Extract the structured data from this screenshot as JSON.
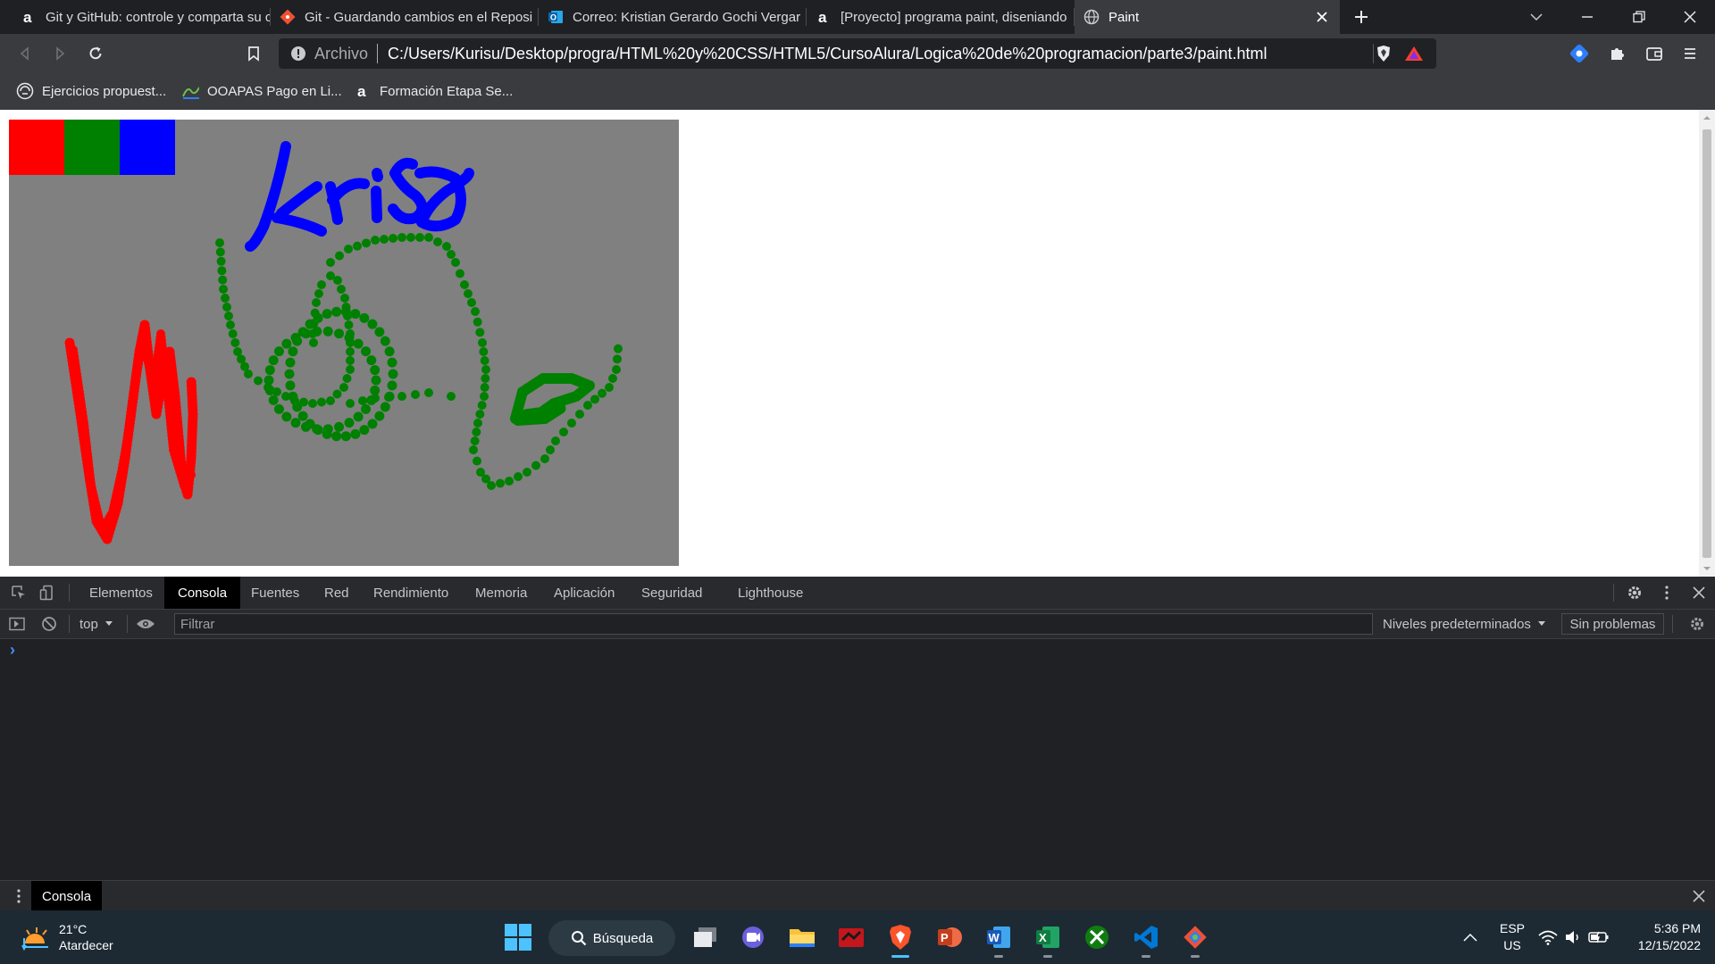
{
  "tabs": [
    {
      "title": "Git y GitHub: controle y comparta su c",
      "icon": "alura-icon"
    },
    {
      "title": "Git - Guardando cambios en el Reposi",
      "icon": "git-icon"
    },
    {
      "title": "Correo: Kristian Gerardo Gochi Vergar",
      "icon": "outlook-icon"
    },
    {
      "title": "[Proyecto] programa paint, diseniando",
      "icon": "alura-icon"
    },
    {
      "title": "Paint",
      "icon": "globe-icon",
      "active": true
    }
  ],
  "address_bar": {
    "scheme_label": "Archivo",
    "url": "C:/Users/Kurisu/Desktop/progra/HTML%20y%20CSS/HTML5/CursoAlura/Logica%20de%20programacion/parte3/paint.html"
  },
  "bookmarks": [
    {
      "label": "Ejercicios propuest...",
      "icon": "bookmark-site-icon"
    },
    {
      "label": "OOAPAS Pago en Li...",
      "icon": "ooapas-icon"
    },
    {
      "label": "Formación Etapa Se...",
      "icon": "alura-icon"
    }
  ],
  "paint": {
    "palette": [
      {
        "name": "red",
        "color": "#ff0000"
      },
      {
        "name": "green",
        "color": "#008000"
      },
      {
        "name": "blue",
        "color": "#0000ff"
      }
    ],
    "canvas_color": "#808080"
  },
  "devtools": {
    "tabs": [
      "Elementos",
      "Consola",
      "Fuentes",
      "Red",
      "Rendimiento",
      "Memoria",
      "Aplicación",
      "Seguridad",
      "Lighthouse"
    ],
    "active_tab": "Consola",
    "context": "top",
    "filter_placeholder": "Filtrar",
    "levels": "Niveles predeterminados",
    "issues": "Sin problemas",
    "prompt": "›",
    "drawer_tab": "Consola"
  },
  "taskbar": {
    "weather": {
      "temp": "21°C",
      "desc": "Atardecer"
    },
    "search_label": "Búsqueda",
    "apps": [
      "task-view",
      "chat",
      "file-explorer",
      "app",
      "brave",
      "powerpoint",
      "word",
      "excel",
      "xbox",
      "vscode",
      "git"
    ],
    "language": {
      "line1": "ESP",
      "line2": "US"
    },
    "time": "5:36 PM",
    "date": "12/15/2022"
  }
}
